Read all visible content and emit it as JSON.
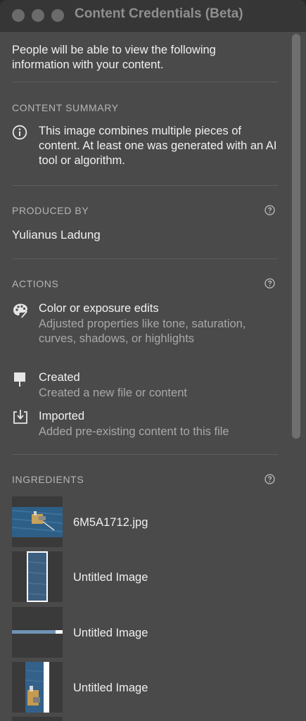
{
  "window": {
    "title": "Content Credentials (Beta)"
  },
  "intro": "People will be able to view the following information with your content.",
  "content_summary": {
    "label": "CONTENT SUMMARY",
    "icon": "info-icon",
    "text": "This image combines multiple pieces of content. At least one was generated with an AI tool or algorithm."
  },
  "produced_by": {
    "label": "PRODUCED BY",
    "name": "Yulianus Ladung"
  },
  "actions": {
    "label": "ACTIONS",
    "items": [
      {
        "icon": "palette-icon",
        "title": "Color or exposure edits",
        "desc": "Adjusted properties like tone, saturation, curves, shadows, or highlights"
      },
      {
        "icon": "created-icon",
        "title": "Created",
        "desc": "Created a new file or content"
      },
      {
        "icon": "import-icon",
        "title": "Imported",
        "desc": "Added pre-existing content to this file"
      }
    ]
  },
  "ingredients": {
    "label": "INGREDIENTS",
    "items": [
      {
        "name": "6M5A1712.jpg"
      },
      {
        "name": "Untitled Image"
      },
      {
        "name": "Untitled Image"
      },
      {
        "name": "Untitled Image"
      }
    ]
  },
  "colors": {
    "panel_bg": "#4a4a4a",
    "titlebar_bg": "#363636",
    "text_primary": "#f0f0f0",
    "text_secondary": "#a8a8a8",
    "section_label": "#b5b5b5"
  }
}
